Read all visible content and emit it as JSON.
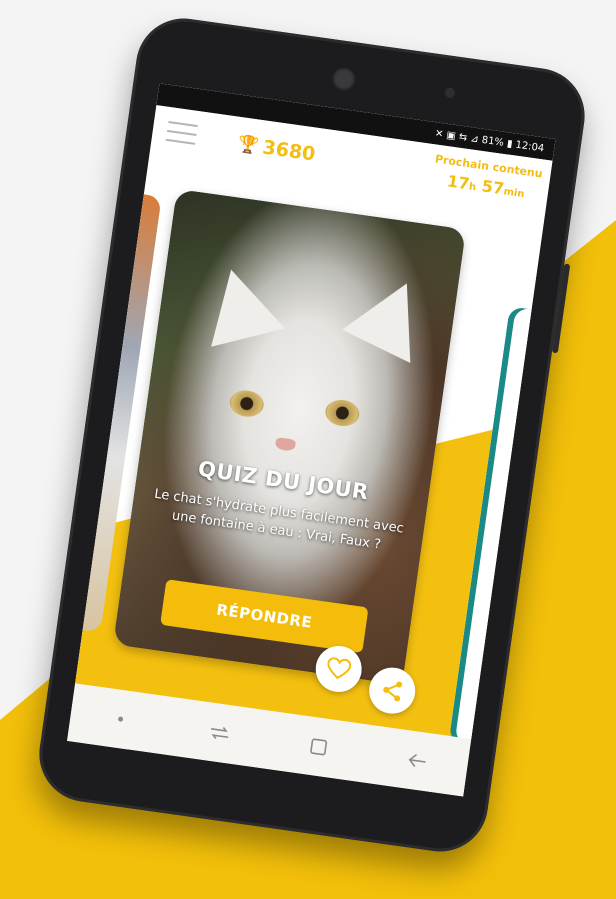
{
  "colors": {
    "accent": "#f2be12",
    "button": "#f5bd0b",
    "background": "#f4f4f4",
    "teal": "#1a8a86"
  },
  "status_bar": {
    "text": "✕ ▣ ⇆ ⊿ 81% ▮ 12:04"
  },
  "header": {
    "menu_icon": "hamburger-menu-icon",
    "trophy_icon": "trophy-icon",
    "score": "3680",
    "next_content_label": "Prochain contenu",
    "countdown_hours": "17",
    "countdown_hours_unit": "h",
    "countdown_minutes": "57",
    "countdown_minutes_unit": "min"
  },
  "card": {
    "title": "QUIZ DU JOUR",
    "question": "Le chat s'hydrate plus facilement avec une fontaine à eau : Vrai, Faux ?",
    "answer_button_label": "RÉPONDRE",
    "like_icon": "heart-icon",
    "share_icon": "share-icon"
  },
  "navbar": {
    "items": [
      "dot-icon",
      "recent-apps-icon",
      "home-square-icon",
      "back-arrow-icon"
    ]
  }
}
